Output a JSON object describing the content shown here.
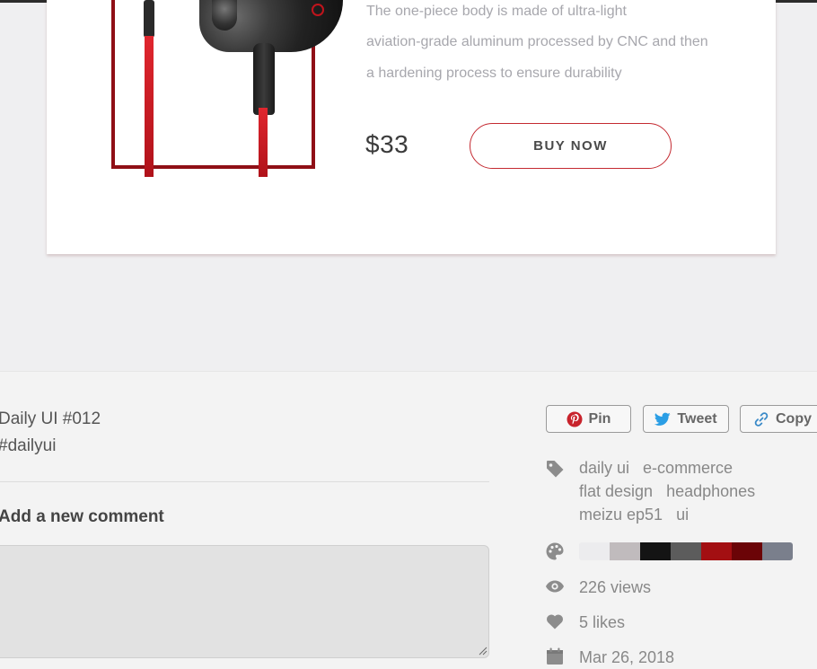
{
  "product": {
    "description_lines": [
      "The one-piece body is made of ultra-light",
      "aviation-grade aluminum processed by CNC and then",
      "a hardening process to ensure durability"
    ],
    "price": "$33",
    "buy_label": "BUY NOW"
  },
  "shot": {
    "title": "Daily UI #012",
    "hashtag": "#dailyui"
  },
  "comments": {
    "heading": "Add a new comment",
    "placeholder": ""
  },
  "share": {
    "pin": "Pin",
    "tweet": "Tweet",
    "copy": "Copy"
  },
  "tags": [
    "daily ui",
    "e-commerce",
    "flat design",
    "headphones",
    "meizu ep51",
    "ui"
  ],
  "palette": [
    "#ececee",
    "#c0bbbd",
    "#141414",
    "#5c5c5c",
    "#a30f12",
    "#6b0407",
    "#7a7f8c"
  ],
  "stats": {
    "views": "226 views",
    "likes": "5 likes",
    "date": "Mar 26, 2018"
  },
  "icons": {
    "tag": "tag-icon",
    "palette": "palette-icon",
    "views": "eye-icon",
    "likes": "heart-icon",
    "date": "calendar-icon"
  }
}
